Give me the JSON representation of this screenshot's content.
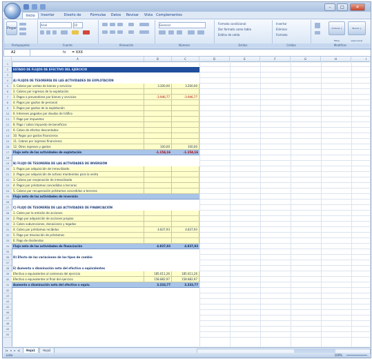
{
  "window": {
    "title": "",
    "controls": {
      "minimize": "–",
      "maximize": "□",
      "close": "✕"
    }
  },
  "ribbon": {
    "tabs": [
      "Inicio",
      "Insertar",
      "Diseño de página",
      "Fórmulas",
      "Datos",
      "Revisar",
      "Vista",
      "Complementos"
    ],
    "active_tab": 0,
    "groups": [
      "Portapapeles",
      "Fuente",
      "Alineación",
      "Número",
      "Estilos",
      "Celdas",
      "Modificar"
    ],
    "paste_label": "Pegar",
    "font_name": "Arial",
    "font_size": "10",
    "number_format": "General",
    "style_buttons": [
      "Formato condicional",
      "Dar formato como tabla",
      "Estilos de celda"
    ],
    "cell_buttons": [
      "Insertar",
      "Eliminar",
      "Formato"
    ],
    "edit_buttons": [
      "Ordenar y filtrar",
      "Buscar y seleccionar"
    ]
  },
  "formula_bar": {
    "name_box": "A2",
    "fx": "fx",
    "content": "= XXX"
  },
  "sheet": {
    "columns": [
      "A",
      "B",
      "C",
      "D",
      "E",
      "F",
      "G",
      "H",
      "I",
      "J"
    ],
    "row_numbers": [
      1,
      2,
      3,
      4,
      5,
      6,
      7,
      8,
      9,
      10,
      11,
      12,
      13,
      14,
      15,
      16,
      17,
      18,
      19,
      20,
      21,
      22,
      23,
      24,
      25,
      26,
      27,
      28,
      29,
      30,
      31,
      32,
      33,
      34,
      35,
      36,
      37,
      38,
      39,
      40,
      41,
      42,
      43,
      44,
      45,
      46,
      47,
      48,
      49,
      50
    ],
    "rows": [
      {
        "style": "blank",
        "a": "",
        "b": "",
        "c": ""
      },
      {
        "style": "darkhdr",
        "a": "ESTADO DE FLUJOS DE EFECTIVO DEL EJERCICIO",
        "b": "",
        "c": ""
      },
      {
        "style": "blank",
        "a": "",
        "b": "",
        "c": ""
      },
      {
        "style": "section",
        "a": "A) FLUJOS DE TESORERÍA DE LAS ACTIVIDADES DE EXPLOTACIÓN",
        "b": "",
        "c": ""
      },
      {
        "style": "yellow",
        "a": "1. Cobros por ventas de bienes y servicios",
        "b": "3.200,00",
        "c": "3.200,00"
      },
      {
        "style": "yellow",
        "a": "2. Cobros por ingresos de la explotación",
        "b": "",
        "c": ""
      },
      {
        "style": "yellow",
        "a": "3. Pagos a proveedores por bienes y servicios",
        "b": "-3.946,77",
        "c": "-3.946,77"
      },
      {
        "style": "yellow",
        "a": "4. Pagos por gastos de personal",
        "b": "",
        "c": ""
      },
      {
        "style": "yellow",
        "a": "5. Pagos por gastos de la explotación",
        "b": "",
        "c": ""
      },
      {
        "style": "yellow",
        "a": "6. Intereses pagados por deudas de tráfico",
        "b": "",
        "c": ""
      },
      {
        "style": "yellow",
        "a": "7. Pago por impuestos",
        "b": "",
        "c": ""
      },
      {
        "style": "yellow",
        "a": "8. Pago / cobro impuesto de beneficios",
        "b": "",
        "c": ""
      },
      {
        "style": "yellow",
        "a": "9. Cobro de efectos descontados",
        "b": "",
        "c": ""
      },
      {
        "style": "yellow",
        "a": "10. Pagos por gastos financieros",
        "b": "",
        "c": ""
      },
      {
        "style": "yellow",
        "a": "11. Cobros por ingresos financieros",
        "b": "",
        "c": ""
      },
      {
        "style": "yellow",
        "a": "12. Otros ingresos y gastos",
        "b": "100,00",
        "c": "100,00"
      },
      {
        "style": "blue",
        "a": "Flujo neto de las actividades de explotación",
        "b": "-1.154,16",
        "c": "-1.154,16"
      },
      {
        "style": "blank",
        "a": "",
        "b": "",
        "c": ""
      },
      {
        "style": "section",
        "a": "B) FLUJO DE TESORERÍA DE LAS ACTIVIDADES DE INVERSIÓN",
        "b": "",
        "c": ""
      },
      {
        "style": "yellow",
        "a": "1. Pagos por adquisición de inmovilizado",
        "b": "",
        "c": ""
      },
      {
        "style": "yellow",
        "a": "2. Pagos por adquisición de activos mantenidos para la venta",
        "b": "",
        "c": ""
      },
      {
        "style": "yellow",
        "a": "3. Cobros por enajenación de inmovilizado",
        "b": "",
        "c": ""
      },
      {
        "style": "yellow",
        "a": "4. Pagos por préstamos concedidos a terceros",
        "b": "",
        "c": ""
      },
      {
        "style": "yellow",
        "a": "5. Cobros por recuperación préstamos concedidos a terceros",
        "b": "",
        "c": ""
      },
      {
        "style": "blue",
        "a": "Flujo neto de las actividades de inversión",
        "b": "",
        "c": ""
      },
      {
        "style": "blank",
        "a": "",
        "b": "",
        "c": ""
      },
      {
        "style": "section",
        "a": "C) FLUJO DE TESORERÍA DE LAS ACTIVIDADES DE FINANCIACIÓN",
        "b": "",
        "c": ""
      },
      {
        "style": "yellow",
        "a": "1. Cobro por la emisión de acciones",
        "b": "",
        "c": ""
      },
      {
        "style": "yellow",
        "a": "2. Pago por adquisición de acciones propias",
        "b": "",
        "c": ""
      },
      {
        "style": "yellow",
        "a": "3. Cobro subvenciones, donaciones y legados",
        "b": "",
        "c": ""
      },
      {
        "style": "yellow",
        "a": "4. Cobro por préstamos recibidos",
        "b": "4.837,93",
        "c": "4.837,93"
      },
      {
        "style": "yellow",
        "a": "5. Pago por devolución de préstamos",
        "b": "",
        "c": ""
      },
      {
        "style": "yellow",
        "a": "6. Pago de dividendos",
        "b": "",
        "c": ""
      },
      {
        "style": "blue",
        "a": "Flujo neto de las actividades de financiación",
        "b": "4.837,93",
        "c": "4.837,93"
      },
      {
        "style": "blank",
        "a": "",
        "b": "",
        "c": ""
      },
      {
        "style": "section",
        "a": "D) Efecto de las variaciones de los tipos de cambio",
        "b": "",
        "c": ""
      },
      {
        "style": "blank",
        "a": "",
        "b": "",
        "c": ""
      },
      {
        "style": "section",
        "a": "E) Aumento o disminución neta del efectivo o equivalentes",
        "b": "",
        "c": ""
      },
      {
        "style": "yellow",
        "a": "Efectivo o equivalentes al comienzo del ejercicio",
        "b": "185.611,26",
        "c": "185.611,26"
      },
      {
        "style": "yellow",
        "a": "Efectivo o equivalentes al final del ejercicio",
        "b": "158.882,97",
        "c": "158.882,97"
      },
      {
        "style": "blue",
        "a": "Aumento o disminución neta del efectivo o equiv.",
        "b": "3.333,77",
        "c": "3.333,77"
      }
    ],
    "tabs": [
      "Hoja1",
      "Hoja2"
    ]
  },
  "status": {
    "text": "Listo",
    "zoom": "100%"
  }
}
